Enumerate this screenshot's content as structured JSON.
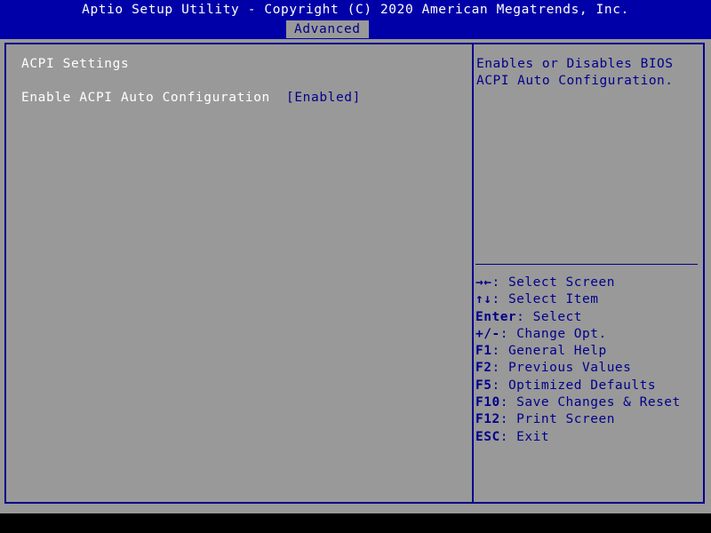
{
  "window": {
    "title": "Aptio Setup Utility - Copyright (C) 2020 American Megatrends, Inc."
  },
  "colors": {
    "header_blue": "#0000a8",
    "text_blue": "#00008c",
    "background_gray": "#999999",
    "text_white": "#ffffff",
    "footer_black": "#000000"
  },
  "tabs": [
    {
      "label": "Advanced",
      "selected": true
    }
  ],
  "settings_pane": {
    "group_title": "ACPI Settings",
    "rows": [
      {
        "label": "Enable ACPI Auto Configuration",
        "value": "[Enabled]"
      }
    ]
  },
  "help_pane": {
    "description": "Enables or Disables BIOS ACPI Auto Configuration.",
    "legend": [
      {
        "key": "→←",
        "separator": ": ",
        "action": "Select Screen",
        "icon": "left-right-arrow-icon"
      },
      {
        "key": "↑↓",
        "separator": ": ",
        "action": "Select Item",
        "icon": "up-down-arrow-icon"
      },
      {
        "key": "Enter",
        "separator": ": ",
        "action": "Select",
        "icon": "enter-key-icon"
      },
      {
        "key": "+/-",
        "separator": ": ",
        "action": "Change Opt.",
        "icon": "plus-minus-key-icon"
      },
      {
        "key": "F1",
        "separator": ": ",
        "action": "General Help",
        "icon": "f1-key-icon"
      },
      {
        "key": "F2",
        "separator": ": ",
        "action": "Previous Values",
        "icon": "f2-key-icon"
      },
      {
        "key": "F5",
        "separator": ": ",
        "action": "Optimized Defaults",
        "icon": "f5-key-icon"
      },
      {
        "key": "F10",
        "separator": ": ",
        "action": "Save Changes & Reset",
        "icon": "f10-key-icon"
      },
      {
        "key": "F12",
        "separator": ": ",
        "action": "Print Screen",
        "icon": "f12-key-icon"
      },
      {
        "key": "ESC",
        "separator": ": ",
        "action": "Exit",
        "icon": "esc-key-icon"
      }
    ]
  }
}
